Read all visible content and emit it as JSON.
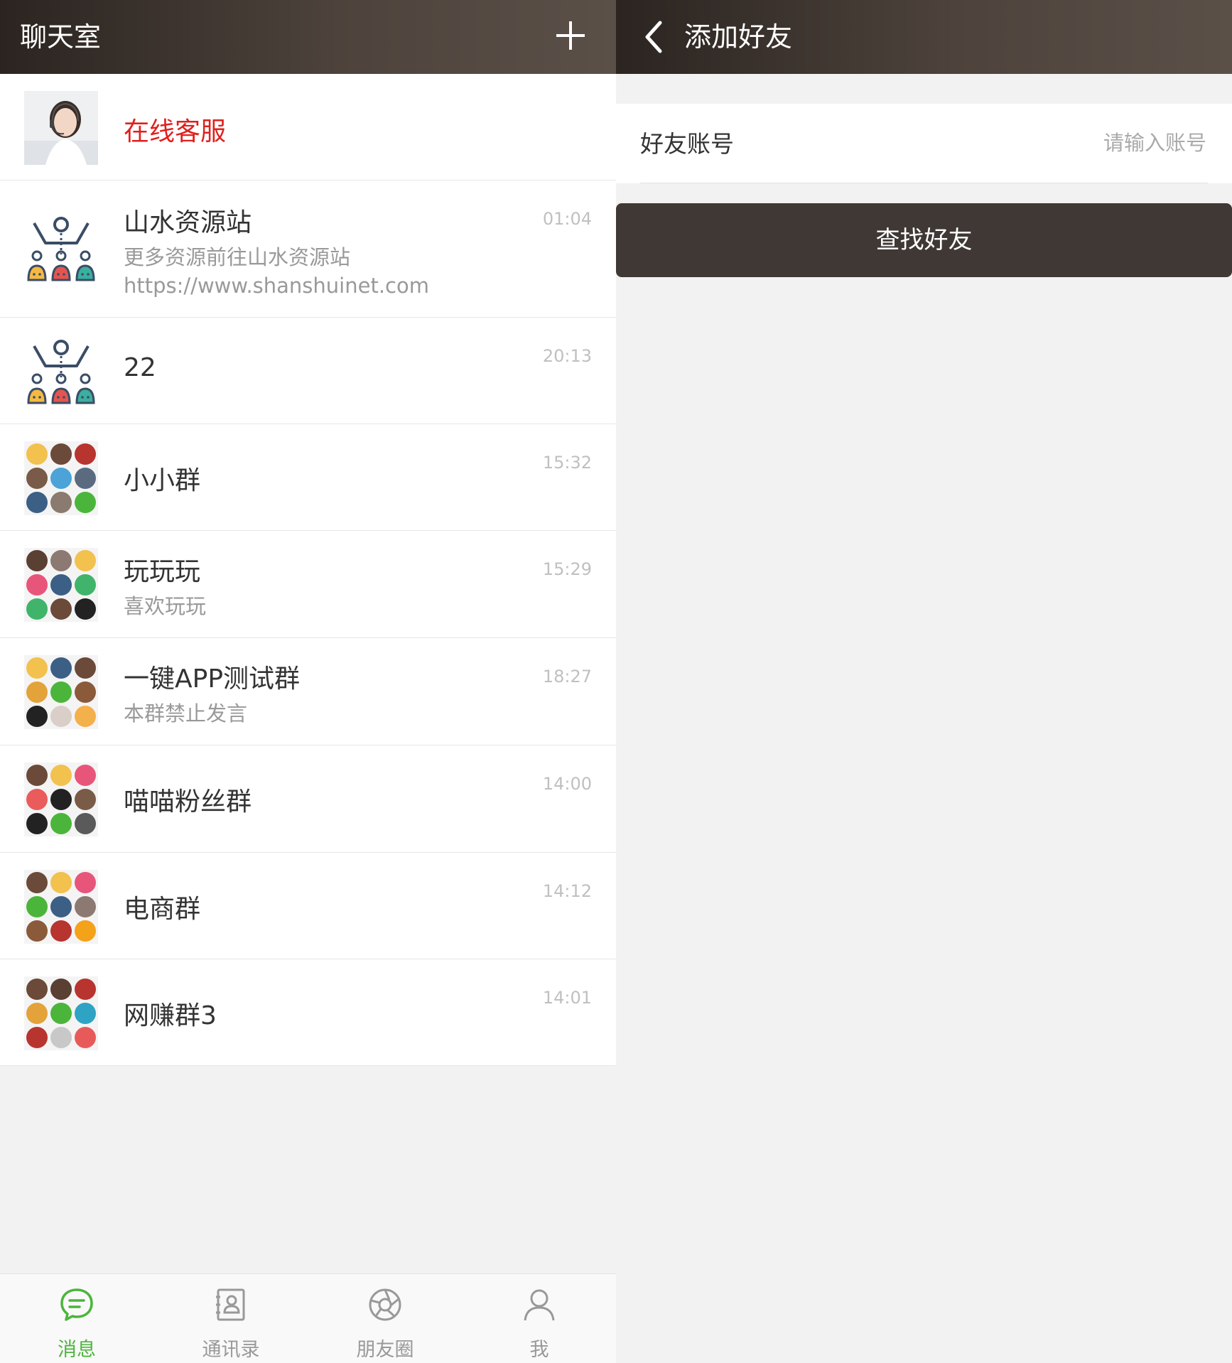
{
  "left_panel": {
    "header": {
      "title": "聊天室"
    },
    "chats": [
      {
        "name": "在线客服",
        "message": "",
        "time": "",
        "avatar": "agent-photo-avatar"
      },
      {
        "name": "山水资源站",
        "message": "更多资源前往山水资源站https://www.shanshuinet.com",
        "time": "01:04",
        "avatar": "group-org-icon"
      },
      {
        "name": "22",
        "message": "",
        "time": "20:13",
        "avatar": "group-org-icon"
      },
      {
        "name": "小小群",
        "message": "",
        "time": "15:32",
        "avatar": "group-collage"
      },
      {
        "name": "玩玩玩",
        "message": "喜欢玩玩",
        "time": "15:29",
        "avatar": "group-collage"
      },
      {
        "name": "一键APP测试群",
        "message": "本群禁止发言",
        "time": "18:27",
        "avatar": "group-collage"
      },
      {
        "name": "喵喵粉丝群",
        "message": "",
        "time": "14:00",
        "avatar": "group-collage"
      },
      {
        "name": "电商群",
        "message": "",
        "time": "14:12",
        "avatar": "group-collage"
      },
      {
        "name": "网赚群3",
        "message": "",
        "time": "14:01",
        "avatar": "group-collage"
      }
    ],
    "tabbar": [
      {
        "label": "消息",
        "icon": "chat-bubble-icon",
        "active": true
      },
      {
        "label": "通讯录",
        "icon": "contacts-book-icon",
        "active": false
      },
      {
        "label": "朋友圈",
        "icon": "aperture-icon",
        "active": false
      },
      {
        "label": "我",
        "icon": "person-icon",
        "active": false
      }
    ]
  },
  "right_panel": {
    "header": {
      "title": "添加好友",
      "back_icon": "chevron-left-icon"
    },
    "form": {
      "label": "好友账号",
      "placeholder": "请输入账号",
      "value": ""
    },
    "button": {
      "label": "查找好友"
    }
  },
  "colors": {
    "header_dark": "#2b2420",
    "active_green": "#4bb53b",
    "name_red": "#e0201d",
    "button_dark": "#3f3835"
  }
}
